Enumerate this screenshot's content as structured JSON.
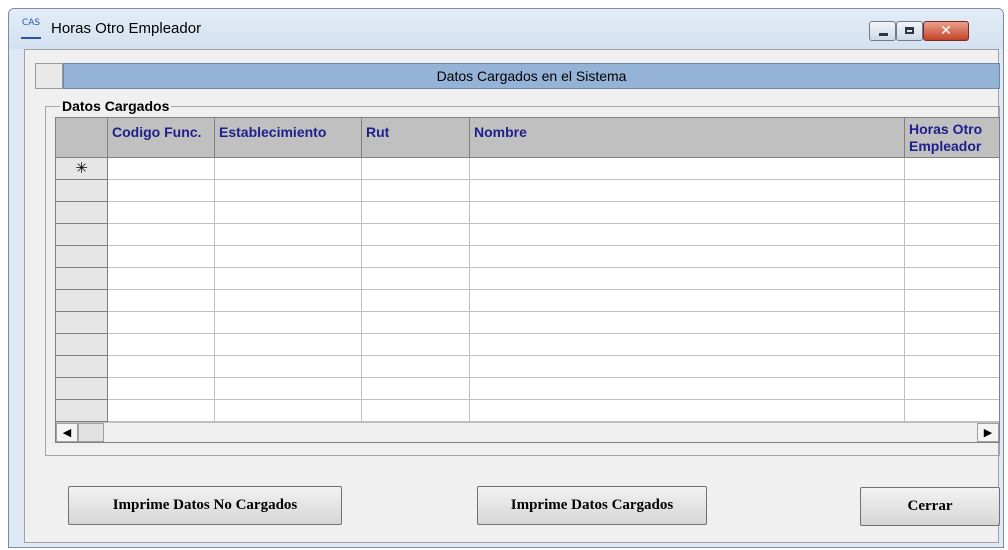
{
  "window": {
    "title": "Horas Otro Empleador",
    "app_icon_text": "CAS"
  },
  "header_bar": {
    "label": "Datos Cargados en el Sistema"
  },
  "group": {
    "label": "Datos Cargados"
  },
  "grid": {
    "columns": [
      {
        "label": "Codigo Func."
      },
      {
        "label": "Establecimiento"
      },
      {
        "label": "Rut"
      },
      {
        "label": "Nombre"
      },
      {
        "label": "Horas Otro Empleador"
      }
    ],
    "new_row_marker": "✳"
  },
  "buttons": {
    "imprime_no_cargados": "Imprime Datos No Cargados",
    "imprime_cargados": "Imprime Datos Cargados",
    "cerrar": "Cerrar"
  },
  "scrollbar": {
    "left_arrow": "◀",
    "right_arrow": "▶"
  },
  "colors": {
    "header_bar_bg": "#95b3d7",
    "grid_header_text": "#1e1e8c",
    "client_bg": "#f0f0f0"
  }
}
